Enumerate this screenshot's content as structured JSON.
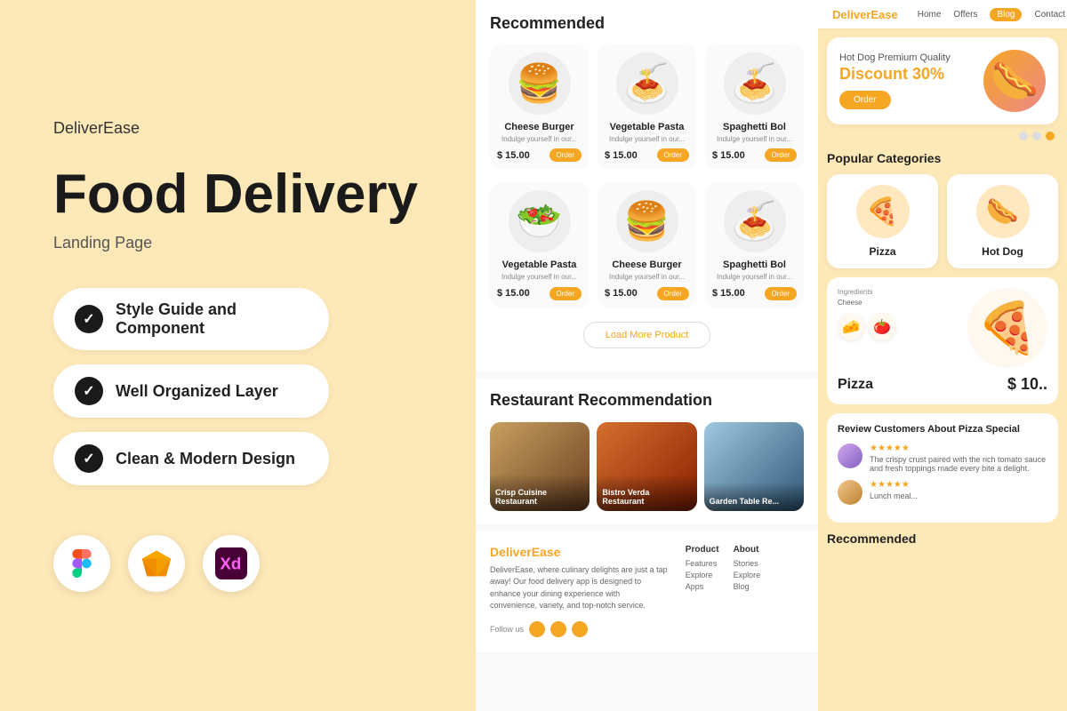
{
  "left": {
    "brand": "DeliverEase",
    "title_line1": "Food Delivery",
    "subtitle": "Landing Page",
    "features": [
      {
        "id": "feature-1",
        "text": "Style Guide and Component"
      },
      {
        "id": "feature-2",
        "text": "Well Organized Layer"
      },
      {
        "id": "feature-3",
        "text": "Clean & Modern Design"
      }
    ],
    "tools": [
      {
        "id": "figma",
        "label": "Figma"
      },
      {
        "id": "sketch",
        "label": "Sketch"
      },
      {
        "id": "xd",
        "label": "Adobe XD"
      }
    ]
  },
  "middle": {
    "recommended_title": "Recommended",
    "food_items_row1": [
      {
        "name": "Cheese Burger",
        "price": "$ 15.00",
        "emoji": "🍔"
      },
      {
        "name": "Vegetable Pasta",
        "price": "$ 15.00",
        "emoji": "🍝"
      },
      {
        "name": "Spaghetti Bol",
        "price": "$ 15.00",
        "emoji": "🍝"
      }
    ],
    "food_items_row2": [
      {
        "name": "Vegetable Pasta",
        "price": "$ 15.00",
        "emoji": "🥗"
      },
      {
        "name": "Cheese Burger",
        "price": "$ 15.00",
        "emoji": "🍔"
      },
      {
        "name": "Spaghetti Bol",
        "price": "$ 15.00",
        "emoji": "🍝"
      }
    ],
    "load_more": "Load More Product",
    "restaurant_title": "Restaurant Recommendation",
    "restaurants": [
      {
        "name": "Crisp Cuisine Restaurant",
        "bg": "rest1"
      },
      {
        "name": "Bistro Verda Restaurant",
        "bg": "rest2"
      },
      {
        "name": "Garden Table Re...",
        "bg": "rest3"
      }
    ],
    "footer_brand": "DeliverEase",
    "footer_desc": "DeliverEase, where culinary delights are just a tap away! Our food delivery app is designed to enhance your dining experience with convenience, variety, and top-notch service.",
    "footer_follow": "Follow us",
    "footer_cols": [
      {
        "title": "Product",
        "items": [
          "Features",
          "Explore",
          "Apps"
        ]
      },
      {
        "title": "About",
        "items": [
          "Stories",
          "Explore",
          "Blog"
        ]
      }
    ]
  },
  "right": {
    "nav_brand": "DeliverEase",
    "nav_items": [
      "Home",
      "Offers",
      "Blog",
      "Contact"
    ],
    "nav_active": "Blog",
    "promo_tag": "Hot Dog Premium Quality",
    "promo_discount": "Discount 30%",
    "promo_btn": "Order",
    "promo_emoji": "🌭",
    "popular_title": "Popular Categories",
    "categories": [
      {
        "name": "Pizza",
        "emoji": "🍕"
      },
      {
        "name": "Hot Dog",
        "emoji": "🌭"
      }
    ],
    "pizza_title": "Pizza",
    "pizza_emoji": "🍕",
    "pizza_price": "$ 10..",
    "pizza_ingredients": "Ingredients",
    "pizza_ingr_item": "Cheese",
    "review_title": "Review Customers About Pizza Special",
    "reviews": [
      {
        "stars": "★★★★★",
        "text": "The crispy crust paired with the rich tomato sauce and fresh toppings made every bite a delight."
      },
      {
        "stars": "★★★★★",
        "text": "Lunch meal..."
      }
    ],
    "recommended_bottom": "Recommended"
  },
  "colors": {
    "orange": "#f5a623",
    "dark": "#1a1a1a",
    "bg_peach": "#fde8b8"
  }
}
